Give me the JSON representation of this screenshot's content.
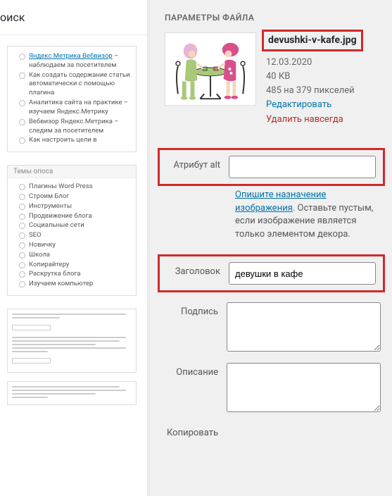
{
  "left": {
    "search": "оиск",
    "box1": [
      {
        "html": "<a>Яндекс Метрика Вебвизор</a> – наблюдаем за посетителем"
      },
      {
        "text": "Как создать содержание статьи автоматически с помощью плагина"
      },
      {
        "text": "Аналитика сайта на практике – изучаем Яндекс.Метрику"
      },
      {
        "text": "Вебвизор Яндекс.Метрика – следим за посетителем"
      },
      {
        "text": "Как настроить цели в"
      }
    ],
    "box2_title": "Темы опоса",
    "box2": [
      "Плагины Word Press",
      "Строим Блог",
      "Инструменты",
      "Продвижение блога",
      "Социальные сети",
      "SEO",
      "Новичку",
      "Школа",
      "Копирайтеру",
      "Раскрутка блога",
      "Изучаем компьютер"
    ]
  },
  "right": {
    "section_title": "ПАРАМЕТРЫ ФАЙЛА",
    "filename": "devushki-v-kafe.jpg",
    "date": "12.03.2020",
    "size": "40 КВ",
    "dimensions": "485 на 379 пикселей",
    "edit": "Редактировать",
    "delete": "Удалить навсегда",
    "labels": {
      "alt": "Атрибут alt",
      "title": "Заголовок",
      "caption": "Подпись",
      "description": "Описание",
      "copy": "Копировать"
    },
    "values": {
      "alt": "",
      "title": "девушки в кафе",
      "caption": "",
      "description": ""
    },
    "help": {
      "link": "Опишите назначение изображения",
      "rest": ". Оставьте пустым, если изображение является только элементом декора."
    }
  }
}
